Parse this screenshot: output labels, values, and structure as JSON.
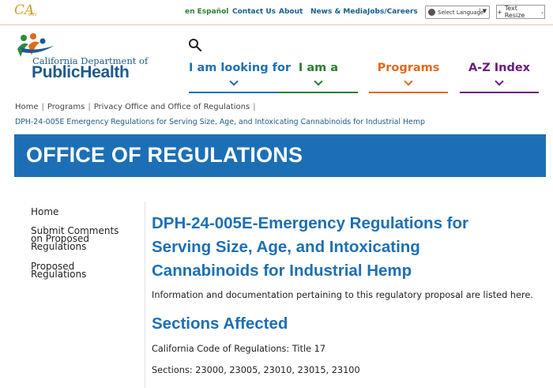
{
  "top_bar": {
    "logo_text": "CA",
    "logo_sub": ".GOV",
    "links": [
      "en Español",
      "Contact Us",
      "About",
      "News & Media",
      "Jobs/Careers"
    ],
    "language_select": "Select Language",
    "text_resize": "Text Resize"
  },
  "header": {
    "logo_line1": "California Department of",
    "logo_line2": "PublicHealth",
    "nav": [
      {
        "label": "I am looking for",
        "color": "#1d6fb5"
      },
      {
        "label": "I am a",
        "color": "#2e7d32"
      },
      {
        "label": "Programs",
        "color": "#e06a1b"
      },
      {
        "label": "A-Z Index",
        "color": "#6a1b7a"
      }
    ]
  },
  "breadcrumb": {
    "items": [
      "Home",
      "Programs",
      "Privacy Office and Office of Regulations"
    ],
    "current": "DPH-24-005E Emergency Regulations for Serving Size, Age, and Intoxicating Cannabinoids for Industrial Hemp"
  },
  "banner": {
    "title": "OFFICE OF REGULATIONS",
    "color": "#1d6fb5"
  },
  "sidebar": {
    "items": [
      {
        "label": "Home"
      },
      {
        "label": "Submit Comments on Proposed Regulations"
      },
      {
        "label": "Proposed Regulations"
      }
    ]
  },
  "main": {
    "title": "DPH-24-005E-Emergency Regulations for Serving Size, Age, and Intoxicating Cannabinoids for Industrial Hemp",
    "intro": "Information and documentation pertaining to this regulatory proposal are listed here.",
    "section_heading": "Sections Affected",
    "code_line": "California Code of Regulations: Title 17",
    "sections_line": "Sections: 23000, 23005, 23010, 23015, 23100"
  }
}
